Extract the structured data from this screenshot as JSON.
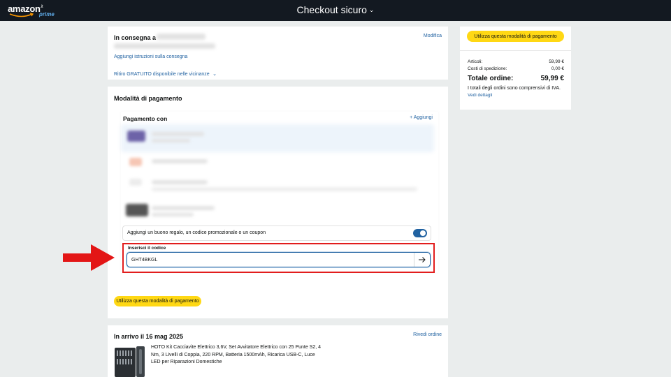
{
  "header": {
    "logo_text": "amazon",
    "logo_tld": ".it",
    "logo_prime": "prime",
    "title": "Checkout sicuro"
  },
  "delivery": {
    "title": "In consegna a",
    "edit_link": "Modifica",
    "instructions_link": "Aggiungi istruzioni sulla consegna",
    "pickup_link": "Ritiro GRATUITO disponibile nelle vicinanze"
  },
  "payment": {
    "title": "Modalità di pagamento",
    "pay_with": "Pagamento con",
    "add_link": "+ Aggiungi",
    "coupon_label": "Aggiungi un buono regalo, un codice promozionale o un coupon",
    "code_label": "Inserisci il codice",
    "code_value": "GHT4BKGL",
    "use_button": "Utilizza questa modalità di pagamento"
  },
  "arrival": {
    "title": "In arrivo il 16 mag 2025",
    "review_link": "Rivedi ordine",
    "product_title": "HOTO Kit Cacciavite Elettrico 3,6V, Set Avvitatore Elettrico con 25 Punte S2, 4 Nm, 3 Livelli di Coppia, 220 RPM, Batteria 1500mAh, Ricarica USB-C, Luce LED per Riparazioni Domestiche"
  },
  "summary": {
    "use_button": "Utilizza questa modalità di pagamento",
    "items_label": "Articoli:",
    "items_value": "59,99 €",
    "shipping_label": "Costi di spedizione:",
    "shipping_value": "0,00 €",
    "total_label": "Totale ordine:",
    "total_value": "59,99 €",
    "tax_note": "I totali degli ordini sono comprensivi di IVA.",
    "details_link": "Vedi dettagli"
  },
  "colors": {
    "header_bg": "#131921",
    "button_yellow": "#ffd814",
    "link_blue": "#2162a1",
    "highlight_red": "#e21d1d"
  }
}
